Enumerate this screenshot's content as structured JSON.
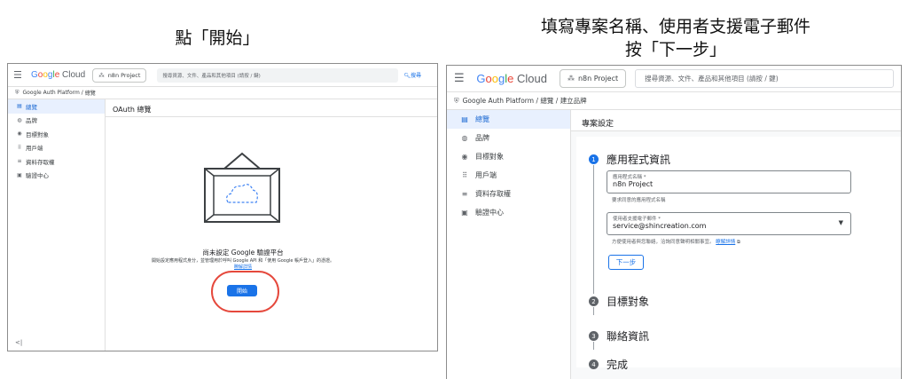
{
  "captions": {
    "left": "點「開始」",
    "right_line1": "填寫專案名稱、使用者支援電子郵件",
    "right_line2": "按「下一步」"
  },
  "header": {
    "logo": {
      "G": "G",
      "o1": "o",
      "o2": "o",
      "g": "g",
      "l": "l",
      "e": "e",
      "cloud": "Cloud"
    },
    "project": "n8n Project",
    "search_placeholder": "搜尋資源、文件、產品和其他項目 (請按 / 鍵)",
    "search_button": "搜尋"
  },
  "left": {
    "breadcrumb": {
      "root": "Google Auth Platform",
      "sep": "/",
      "page": "總覽"
    },
    "nav": [
      {
        "label": "總覽",
        "icon": "dashboard-icon"
      },
      {
        "label": "品牌",
        "icon": "palette-icon"
      },
      {
        "label": "目標對象",
        "icon": "person-icon"
      },
      {
        "label": "用戶端",
        "icon": "grid-icon"
      },
      {
        "label": "資料存取權",
        "icon": "data-access-icon"
      },
      {
        "label": "驗證中心",
        "icon": "calendar-check-icon"
      }
    ],
    "main_title": "OAuth 總覽",
    "empty_title": "尚未設定 Google 驗證平台",
    "empty_desc": "開始設定應用程式身分，並管理用於呼叫 Google API 和「使用 Google 帳戶登入」的憑證。",
    "empty_link": "瞭解詳情",
    "start_button": "開始"
  },
  "right": {
    "breadcrumb": {
      "root": "Google Auth Platform",
      "sep1": "/",
      "mid": "總覽",
      "sep2": "/",
      "page": "建立品牌"
    },
    "nav": [
      {
        "label": "總覽",
        "icon": "dashboard-icon"
      },
      {
        "label": "品牌",
        "icon": "palette-icon"
      },
      {
        "label": "目標對象",
        "icon": "person-icon"
      },
      {
        "label": "用戶端",
        "icon": "grid-icon"
      },
      {
        "label": "資料存取權",
        "icon": "data-access-icon"
      },
      {
        "label": "驗證中心",
        "icon": "calendar-check-icon"
      }
    ],
    "main_title": "專案設定",
    "steps": [
      {
        "num": "1",
        "label": "應用程式資訊"
      },
      {
        "num": "2",
        "label": "目標對象"
      },
      {
        "num": "3",
        "label": "聯絡資訊"
      },
      {
        "num": "4",
        "label": "完成"
      }
    ],
    "app_name_label": "應用程式名稱 *",
    "app_name_value": "n8n Project",
    "app_name_hint": "要求同意的應用程式名稱",
    "email_label": "使用者支援電子郵件 *",
    "email_value": "service@shincreation.com",
    "email_hint": "方便使用者與您聯絡，洽詢同意聲明相關事宜。",
    "email_link": "瞭解詳情",
    "next_button": "下一步"
  },
  "colors": {
    "accent": "#1a73e8",
    "highlight": "#e5483c"
  }
}
